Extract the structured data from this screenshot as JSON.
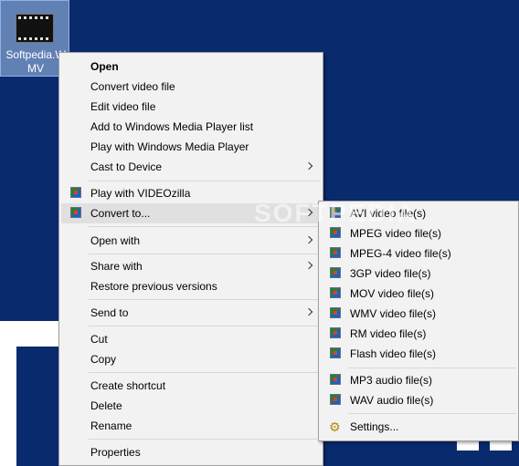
{
  "desktop": {
    "file_icon_label": "Softpedia.WMV"
  },
  "context_menu": {
    "items": [
      {
        "label": "Open",
        "bold": true
      },
      {
        "label": "Convert video file"
      },
      {
        "label": "Edit video file"
      },
      {
        "label": "Add to Windows Media Player list"
      },
      {
        "label": "Play with Windows Media Player"
      },
      {
        "label": "Cast to Device",
        "submenu": true
      },
      {
        "label": "Play with VIDEOzilla",
        "icon": "videozilla-icon"
      },
      {
        "label": "Convert to...",
        "icon": "videozilla-icon",
        "submenu": true,
        "highlighted": true
      },
      {
        "label": "Open with",
        "submenu": true
      },
      {
        "label": "Share with",
        "submenu": true
      },
      {
        "label": "Restore previous versions"
      },
      {
        "label": "Send to",
        "submenu": true
      },
      {
        "label": "Cut"
      },
      {
        "label": "Copy"
      },
      {
        "label": "Create shortcut"
      },
      {
        "label": "Delete"
      },
      {
        "label": "Rename"
      },
      {
        "label": "Properties"
      }
    ]
  },
  "convert_submenu": {
    "items": [
      {
        "label": "AVI video file(s)",
        "icon": "videozilla-icon"
      },
      {
        "label": "MPEG video file(s)",
        "icon": "videozilla-icon"
      },
      {
        "label": "MPEG-4 video file(s)",
        "icon": "videozilla-icon"
      },
      {
        "label": "3GP video file(s)",
        "icon": "videozilla-icon"
      },
      {
        "label": "MOV video file(s)",
        "icon": "videozilla-icon"
      },
      {
        "label": "WMV video file(s)",
        "icon": "videozilla-icon"
      },
      {
        "label": "RM video file(s)",
        "icon": "videozilla-icon"
      },
      {
        "label": "Flash video file(s)",
        "icon": "videozilla-icon"
      },
      {
        "label": "MP3 audio file(s)",
        "icon": "videozilla-icon"
      },
      {
        "label": "WAV audio file(s)",
        "icon": "videozilla-icon"
      },
      {
        "label": "Settings...",
        "icon": "settings-icon"
      }
    ]
  },
  "watermark": "SOFTPEDIA",
  "colors": {
    "desktop_background": "#0a2a6e",
    "menu_background": "#f2f2f2",
    "menu_highlight": "#e0e0e0"
  }
}
